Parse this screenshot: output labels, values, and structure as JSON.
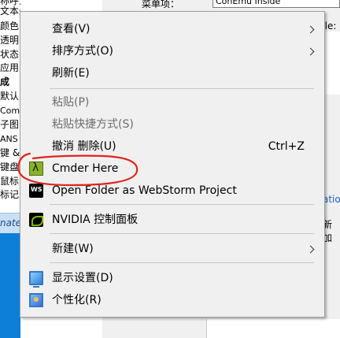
{
  "background": {
    "left_tree": [
      "称呼注",
      "文本光标",
      "颜色",
      "透明",
      "状态",
      "应用",
      "成",
      "默认",
      "Com",
      "子图",
      "ANS",
      "键 &",
      "键盘",
      "鼠标",
      "标记"
    ],
    "left_bar_text": "nate",
    "dialog_label": "菜单项：",
    "dialog_input_value": "ConEmu Inside",
    "cut_table_text": "ble:",
    "cut_blue_text": "atio",
    "cut_new_text": "新加"
  },
  "menu": {
    "items": [
      {
        "label": "查看(V)",
        "has_submenu": true
      },
      {
        "label": "排序方式(O)",
        "has_submenu": true
      },
      {
        "label": "刷新(E)"
      },
      {
        "label": "粘贴(P)",
        "disabled": true
      },
      {
        "label": "粘贴快捷方式(S)",
        "disabled": true
      },
      {
        "label": "撤消 删除(U)",
        "shortcut": "Ctrl+Z"
      },
      {
        "label": "Cmder Here",
        "icon": "cmder-lambda-icon"
      },
      {
        "label": "Open Folder as WebStorm Project",
        "icon": "webstorm-icon"
      },
      {
        "label": "NVIDIA 控制面板",
        "icon": "nvidia-icon"
      },
      {
        "label": "新建(W)",
        "has_submenu": true
      },
      {
        "label": "显示设置(D)",
        "icon": "display-settings-icon"
      },
      {
        "label": "个性化(R)",
        "icon": "personalize-icon"
      }
    ]
  },
  "colors": {
    "menu_bg": "#f0f0f0",
    "disabled_text": "#6d6d6d",
    "annotation_red": "#e0241c",
    "taskbar_blue": "#0e7fd9"
  }
}
